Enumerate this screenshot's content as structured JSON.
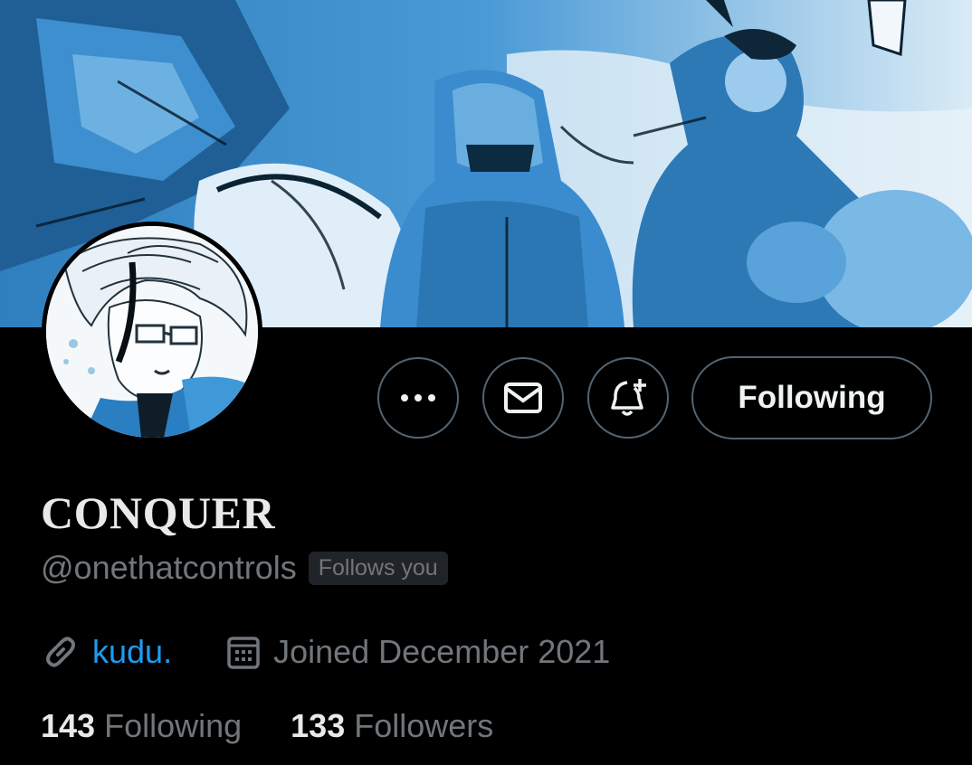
{
  "profile": {
    "display_name": "CONQUER",
    "handle": "@onethatcontrols",
    "follows_you_badge": "Follows you",
    "link_text": "kudu.",
    "joined_text": "Joined December 2021",
    "following_count": "143",
    "following_label": "Following",
    "followers_count": "133",
    "followers_label": "Followers"
  },
  "actions": {
    "more_icon": "more-icon",
    "message_icon": "envelope-icon",
    "notify_icon": "bell-plus-icon",
    "follow_button_label": "Following"
  },
  "icons": {
    "link": "link-icon",
    "calendar": "calendar-icon"
  },
  "colors": {
    "background": "#000000",
    "accent_link": "#1d9bf0",
    "muted_text": "#71767b",
    "border": "#536471",
    "banner_tint": "#3b8ccf"
  }
}
